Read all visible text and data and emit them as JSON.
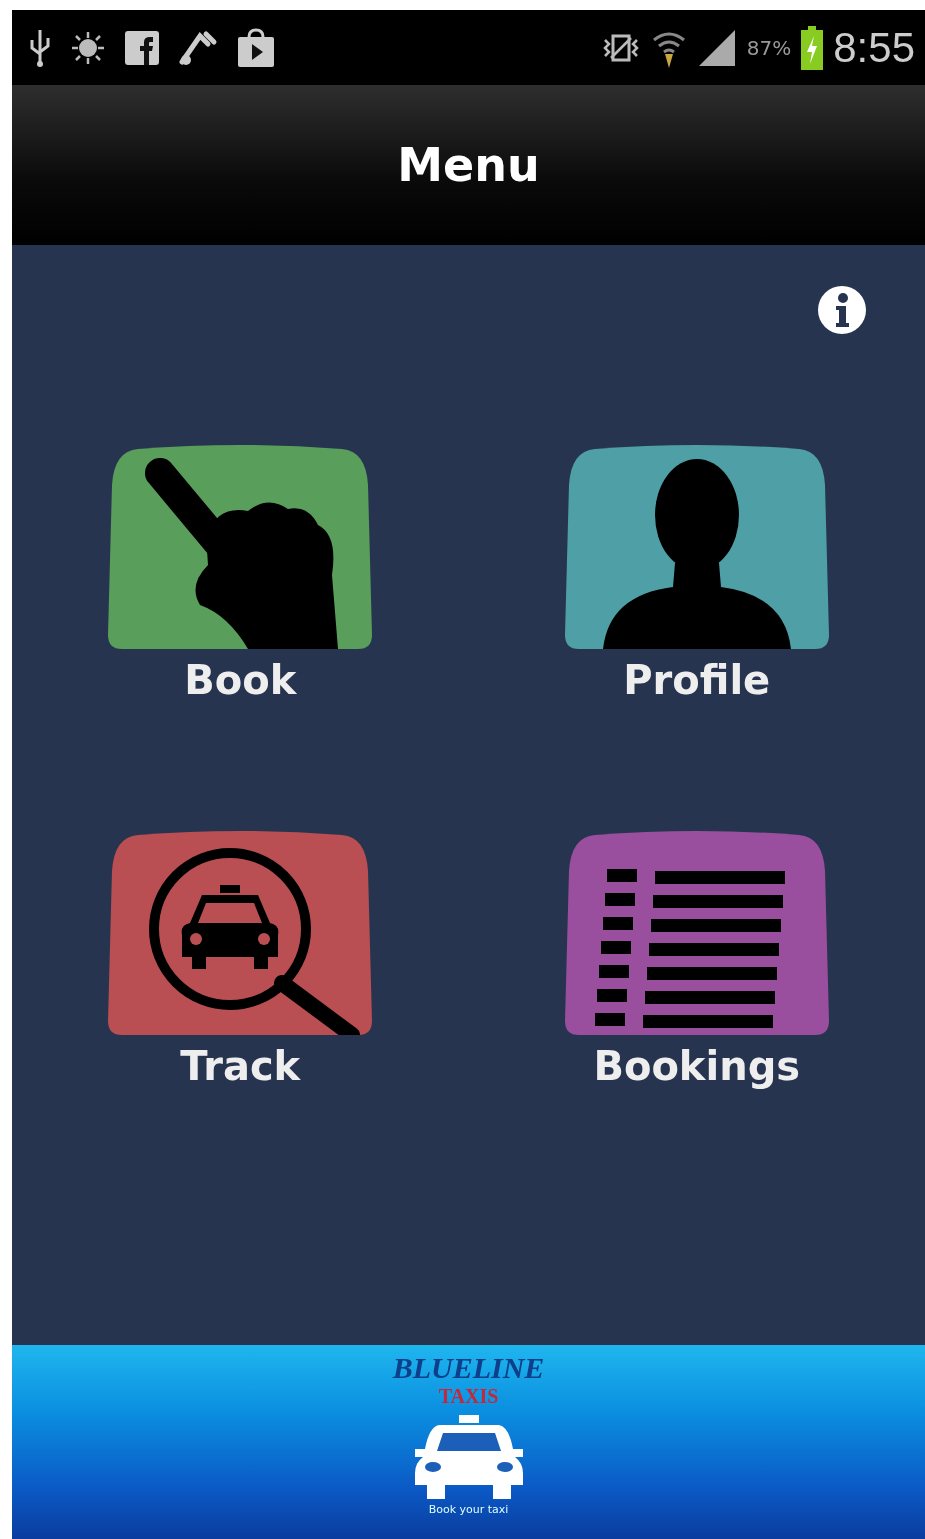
{
  "status_bar": {
    "battery_percent": "87%",
    "time": "8:55"
  },
  "header": {
    "title": "Menu"
  },
  "tiles": [
    {
      "label": "Book",
      "kind": "hand",
      "color": "#5a9e5c"
    },
    {
      "label": "Profile",
      "kind": "person",
      "color": "#4ea0a6"
    },
    {
      "label": "Track",
      "kind": "track",
      "color": "#b94f52"
    },
    {
      "label": "Bookings",
      "kind": "list",
      "color": "#9a4f9e"
    }
  ],
  "banner": {
    "brand": "BLUELINE",
    "subtitle": "TAXIS",
    "tagline": "Book your taxi"
  }
}
